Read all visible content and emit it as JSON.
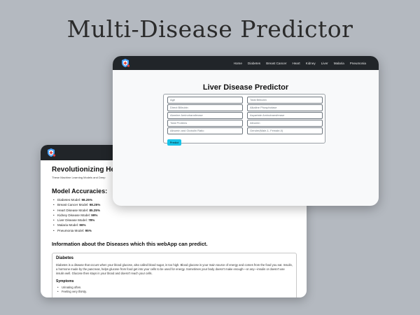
{
  "hero": {
    "title": "Multi-Disease Predictor"
  },
  "back_window": {
    "headline": "Revolutionizing Heal",
    "subtitle": "These Machine Learning Models and Deep",
    "accuracies_heading": "Model Accuracies:",
    "accuracies": [
      {
        "label": "Diabetes Model:",
        "value": "98.25%"
      },
      {
        "label": "Breast Cancer Model:",
        "value": "98.25%"
      },
      {
        "label": "Heart Disease Model:",
        "value": "85.25%"
      },
      {
        "label": "Kidney Disease Model:",
        "value": "99%"
      },
      {
        "label": "Liver Disease Model:",
        "value": "78%"
      },
      {
        "label": "Malaria Model:",
        "value": "96%"
      },
      {
        "label": "Pneumonia Model:",
        "value": "95%"
      }
    ],
    "info_heading": "Information about the Diseases which this webApp can predict.",
    "card": {
      "title": "Diabetes",
      "text": "Diabetes is a disease that occurs when your blood glucose, also called blood sugar, is too high. Blood glucose is your main source of energy and comes from the food you eat. Insulin, a hormone made by the pancreas, helps glucose from food get into your cells to be used for energy. Sometimes your body doesn't make enough—or any—insulin or doesn't use insulin well. Glucose then stays in your blood and doesn't reach your cells.",
      "symptoms_heading": "Symptoms",
      "symptoms": [
        "Urinating often.",
        "Feeling very thirsty."
      ]
    }
  },
  "front_window": {
    "nav": [
      "Home",
      "Diabetes",
      "Breast Cancer",
      "Heart",
      "Kidney",
      "Liver",
      "Malaria",
      "Pneumonia"
    ],
    "form_title": "Liver Disease Predictor",
    "fields": [
      "Age",
      "Total Bilirubin",
      "Direct Bilirubin",
      "Alkaline Phosphotase",
      "Alamine Aminotransferase",
      "Aspartate Aminotransferase",
      "Total Protiens",
      "Albumin",
      "Albumin and Globulin Ratio",
      "Gender(Male-1, Female-0)"
    ],
    "predict_label": "Predict"
  },
  "colors": {
    "background": "#b4b9c0",
    "navbar": "#212529",
    "button": "#17c3e8",
    "logo_shield": "#4da3ff",
    "logo_cross": "#e0403a"
  },
  "icons": {
    "logo": "medical-shield-icon"
  }
}
